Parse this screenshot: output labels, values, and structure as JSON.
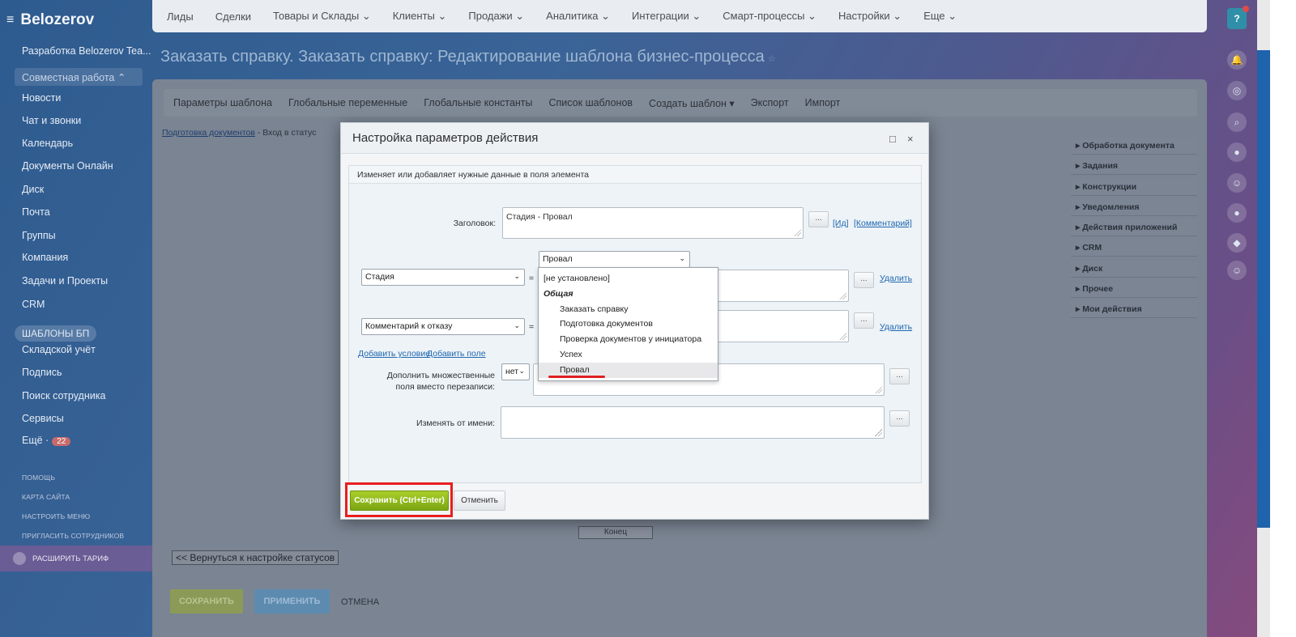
{
  "sidebar": {
    "logo": "Belozerov",
    "items": [
      {
        "label": "Разработка Belozerov Tea..."
      },
      {
        "label": "Совместная работа ⌃"
      },
      {
        "label": "Новости"
      },
      {
        "label": "Чат и звонки"
      },
      {
        "label": "Календарь"
      },
      {
        "label": "Документы Онлайн"
      },
      {
        "label": "Диск"
      },
      {
        "label": "Почта"
      },
      {
        "label": "Группы"
      },
      {
        "label": "Компания"
      },
      {
        "label": "Задачи и Проекты"
      },
      {
        "label": "CRM"
      },
      {
        "label": "ШАБЛОНЫ БП"
      },
      {
        "label": "Складской учёт"
      },
      {
        "label": "Подпись"
      },
      {
        "label": "Поиск сотрудника"
      },
      {
        "label": "Сервисы"
      },
      {
        "label": "Ещё ·"
      }
    ],
    "more_badge": "22",
    "small_links": [
      "ПОМОЩЬ",
      "КАРТА САЙТА",
      "НАСТРОИТЬ МЕНЮ",
      "ПРИГЛАСИТЬ СОТРУДНИКОВ"
    ],
    "tariff": "РАСШИРИТЬ ТАРИФ"
  },
  "topnav": [
    "Лиды",
    "Сделки",
    "Товары и Склады ⌄",
    "Клиенты ⌄",
    "Продажи ⌄",
    "Аналитика ⌄",
    "Интеграции ⌄",
    "Смарт-процессы ⌄",
    "Настройки ⌄",
    "Еще ⌄"
  ],
  "page": {
    "title": "Заказать справку. Заказать справку: Редактирование шаблона бизнес-процесса",
    "title_star": "☆"
  },
  "toolbar": [
    "Параметры шаблона",
    "Глобальные переменные",
    "Глобальные константы",
    "Список шаблонов",
    "Создать шаблон ▾",
    "Экспорт",
    "Импорт"
  ],
  "breadcrumb": {
    "link": "Подготовка документов",
    "rest": " - Вход в статус"
  },
  "right_panel": [
    "Обработка документа",
    "Задания",
    "Конструкции",
    "Уведомления",
    "Действия приложений",
    "CRM",
    "Диск",
    "Прочее",
    "Мои действия"
  ],
  "canvas": {
    "end_block": "Конец",
    "back_button": "<< Вернуться к настройке статусов"
  },
  "bottom": {
    "save": "СОХРАНИТЬ",
    "apply": "ПРИМЕНИТЬ",
    "cancel": "ОТМЕНА"
  },
  "modal": {
    "title": "Настройка параметров действия",
    "maximize": "□",
    "close": "×",
    "description": "Изменяет или добавляет нужные данные в поля элемента",
    "title_label": "Заголовок:",
    "title_value": "Стадия - Провал",
    "dots": "...",
    "id_link": "[Ид]",
    "comment_link": "[Комментарий]",
    "field1": "Стадия",
    "field2": "Комментарий к отказу",
    "equals": "=",
    "value_select": "Провал",
    "delete": "Удалить",
    "add_condition": "Добавить условие",
    "add_field": "Добавить поле",
    "multi_label": "Дополнить множественные поля вместо перезаписи:",
    "multi_value": "нет",
    "as_user_label": "Изменять от имени:",
    "save": "Сохранить (Ctrl+Enter)",
    "cancel": "Отменить"
  },
  "dropdown": {
    "not_set": "[не установлено]",
    "group": "Общая",
    "options": [
      "Заказать справку",
      "Подготовка документов",
      "Проверка документов у инициатора",
      "Успех",
      "Провал"
    ]
  },
  "colors": {
    "accent_green": "#8bc01c",
    "highlight_red": "#e81e1e",
    "link": "#2067b0"
  }
}
